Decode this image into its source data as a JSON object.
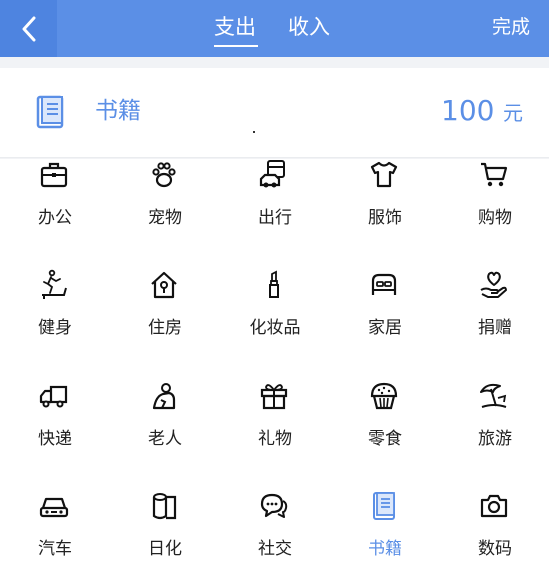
{
  "header": {
    "tabs": [
      {
        "label": "支出",
        "active": true
      },
      {
        "label": "收入",
        "active": false
      }
    ],
    "done_label": "完成",
    "back_icon": "chevron-left-icon",
    "background": "#5b8fe6"
  },
  "entry": {
    "category": "书籍",
    "amount": "100",
    "currency": "元",
    "icon": "book-icon",
    "accent": "#5b8fe6"
  },
  "categories": [
    {
      "label": "办公",
      "icon": "briefcase-icon"
    },
    {
      "label": "宠物",
      "icon": "paw-icon"
    },
    {
      "label": "出行",
      "icon": "car-bus-icon"
    },
    {
      "label": "服饰",
      "icon": "tshirt-icon"
    },
    {
      "label": "购物",
      "icon": "shopping-cart-icon"
    },
    {
      "label": "健身",
      "icon": "treadmill-icon"
    },
    {
      "label": "住房",
      "icon": "house-key-icon"
    },
    {
      "label": "化妆品",
      "icon": "lipstick-icon"
    },
    {
      "label": "家居",
      "icon": "bed-icon"
    },
    {
      "label": "捐赠",
      "icon": "heart-hand-icon"
    },
    {
      "label": "快递",
      "icon": "delivery-truck-icon"
    },
    {
      "label": "老人",
      "icon": "elderly-icon"
    },
    {
      "label": "礼物",
      "icon": "gift-icon"
    },
    {
      "label": "零食",
      "icon": "muffin-icon"
    },
    {
      "label": "旅游",
      "icon": "beach-umbrella-icon"
    },
    {
      "label": "汽车",
      "icon": "car-icon"
    },
    {
      "label": "日化",
      "icon": "toilet-paper-icon"
    },
    {
      "label": "社交",
      "icon": "chat-bubbles-icon"
    },
    {
      "label": "书籍",
      "icon": "book-icon",
      "selected": true
    },
    {
      "label": "数码",
      "icon": "camera-icon"
    }
  ]
}
